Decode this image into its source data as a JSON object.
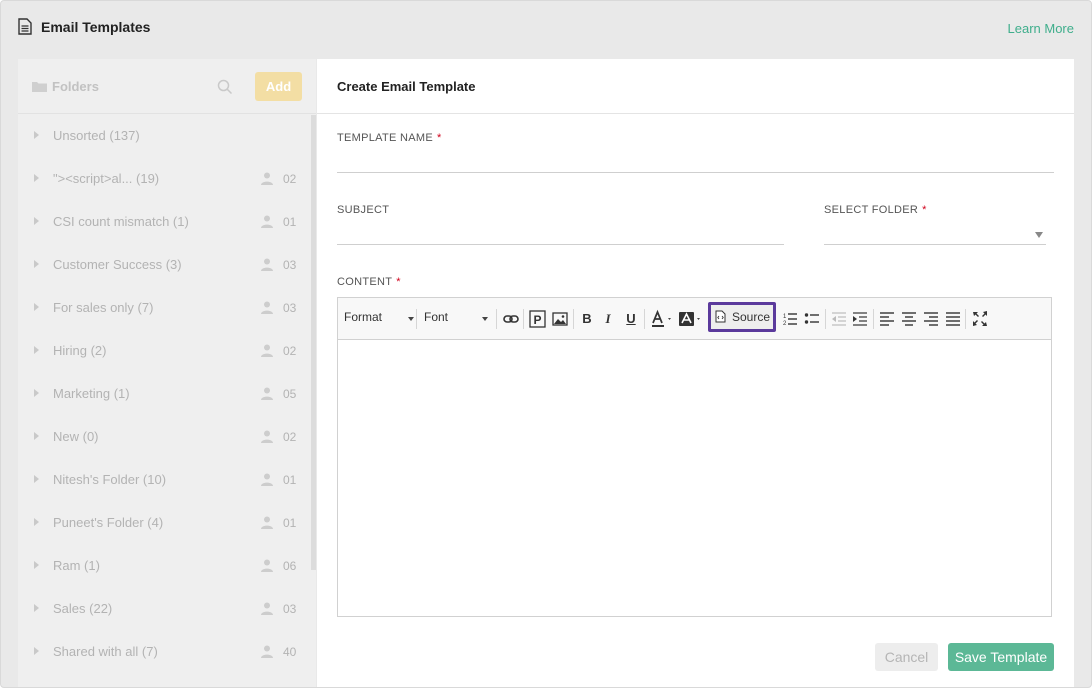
{
  "header": {
    "title": "Email Templates",
    "learn_more": "Learn More",
    "icon": "document-icon"
  },
  "sidebar": {
    "title": "Folders",
    "add_label": "Add",
    "folders": [
      {
        "name": "Unsorted (137)",
        "users": ""
      },
      {
        "name": "\"><script>al... (19)",
        "users": "02"
      },
      {
        "name": "CSI count mismatch (1)",
        "users": "01"
      },
      {
        "name": "Customer Success (3)",
        "users": "03"
      },
      {
        "name": "For sales only (7)",
        "users": "03"
      },
      {
        "name": "Hiring (2)",
        "users": "02"
      },
      {
        "name": "Marketing (1)",
        "users": "05"
      },
      {
        "name": "New (0)",
        "users": "02"
      },
      {
        "name": "Nitesh's Folder (10)",
        "users": "01"
      },
      {
        "name": "Puneet's Folder (4)",
        "users": "01"
      },
      {
        "name": "Ram (1)",
        "users": "06"
      },
      {
        "name": "Sales (22)",
        "users": "03"
      },
      {
        "name": "Shared with all (7)",
        "users": "40"
      }
    ]
  },
  "main": {
    "title": "Create Email Template",
    "template_name_label": "TEMPLATE NAME",
    "template_name_value": "",
    "subject_label": "SUBJECT",
    "subject_value": "",
    "folder_label": "SELECT FOLDER",
    "folder_value": "",
    "content_label": "CONTENT",
    "required_mark": "*",
    "toolbar": {
      "format_label": "Format",
      "font_label": "Font",
      "bold": "B",
      "italic": "I",
      "underline": "U",
      "source_label": "Source"
    },
    "cancel_label": "Cancel",
    "save_label": "Save Template"
  },
  "colors": {
    "accent_green": "#3fae8c",
    "save_button": "#5cb896",
    "add_button": "#f3dea4",
    "source_highlight": "#5b3a9c"
  }
}
